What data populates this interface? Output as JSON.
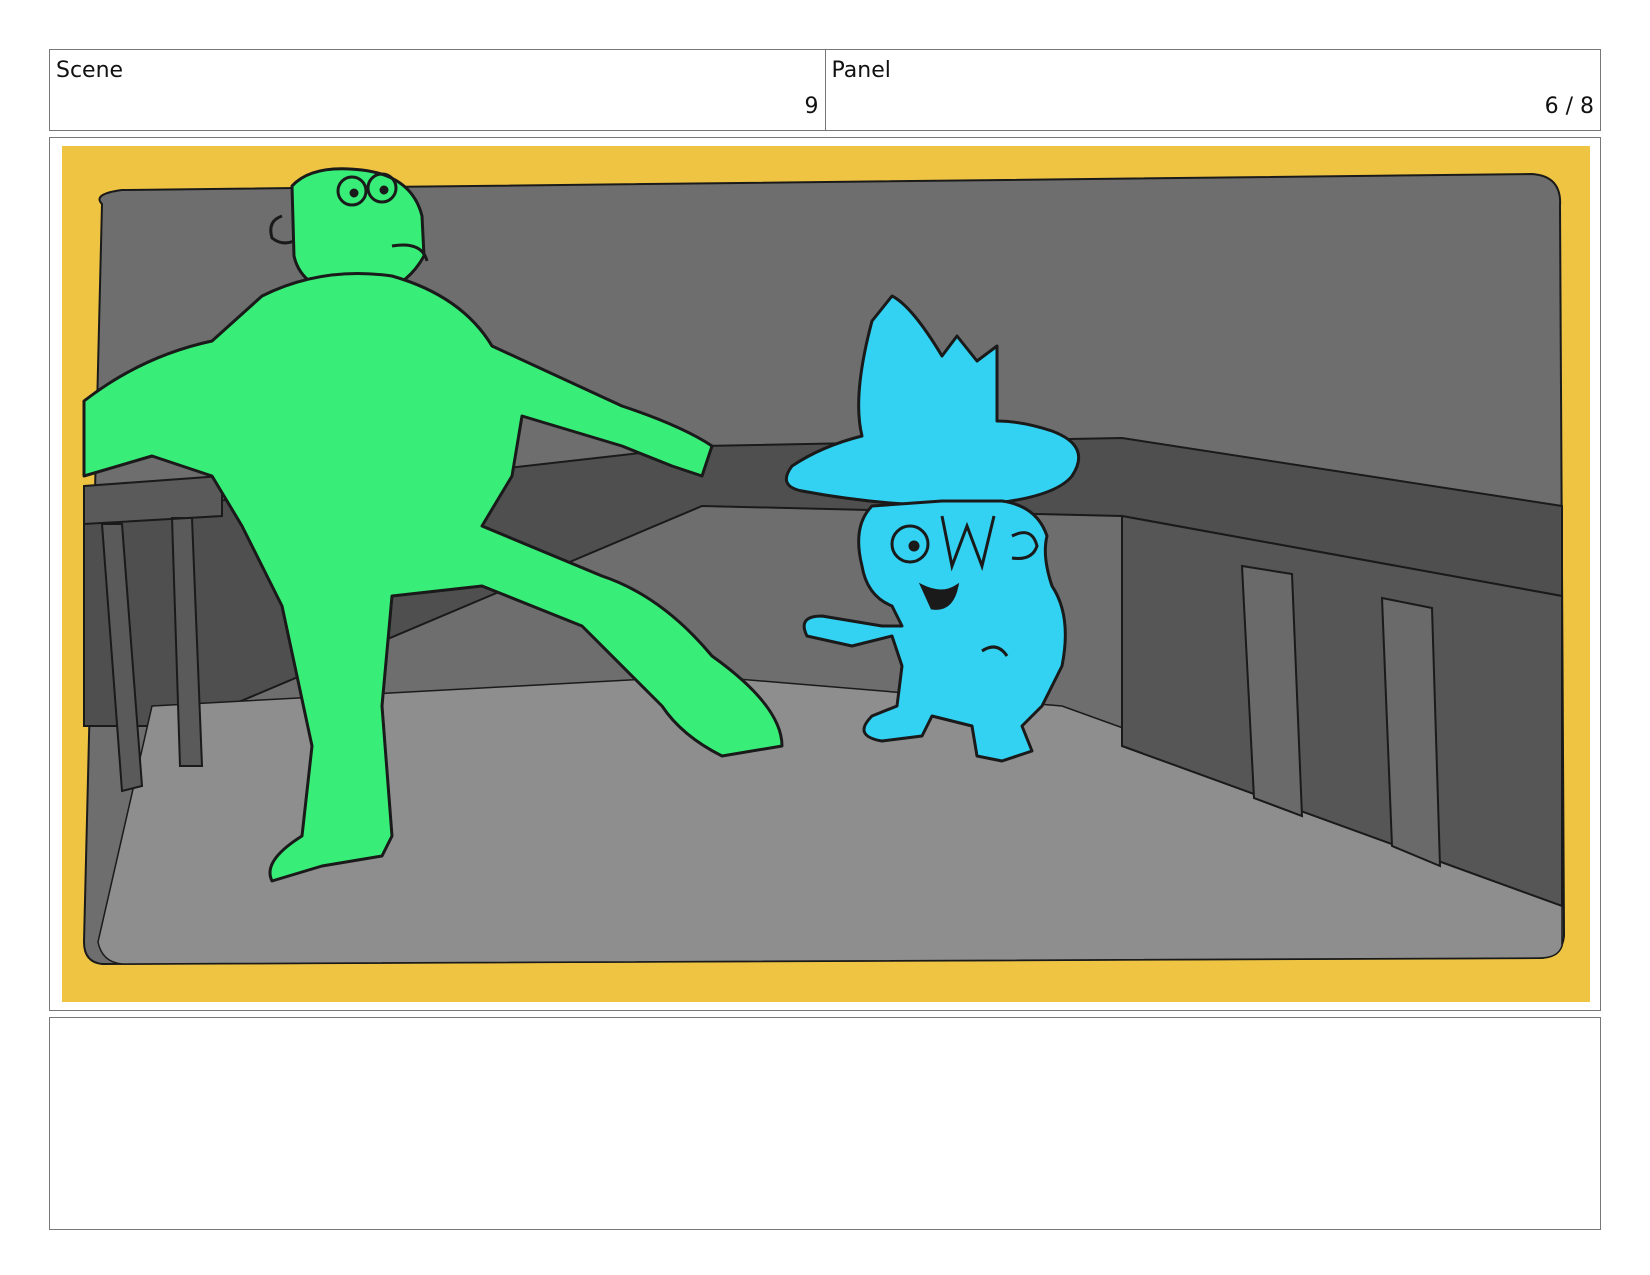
{
  "header": {
    "scene_label": "Scene",
    "scene_value": "9",
    "panel_label": "Panel",
    "panel_value": "6 / 8"
  },
  "colors": {
    "border_yellow": "#EFC443",
    "wall_gray": "#6E6E6E",
    "floor_gray": "#8E8E8E",
    "counter_dark": "#4F4F4F",
    "character_green": "#38EE78",
    "character_blue": "#33D1F2",
    "outline": "#1a1a1a"
  },
  "notes": {
    "text": ""
  }
}
